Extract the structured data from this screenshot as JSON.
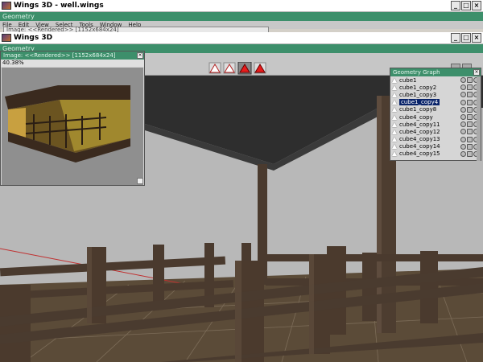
{
  "outer_window": {
    "title": "Wings 3D - well.wings",
    "geometry_label": "Geometry"
  },
  "menus": [
    "File",
    "Edit",
    "View",
    "Select",
    "Tools",
    "Window",
    "Help"
  ],
  "image_title_strip": "Image: <<Rendered>> [1152x684x24]",
  "inner_window": {
    "title": "Wings 3D",
    "geometry_label": "Geometry"
  },
  "image_window": {
    "title": "Image: <<Rendered>> [1152x684x24]",
    "zoom": "40.38%"
  },
  "selection_mode_buttons": [
    "vertex-mode",
    "edge-mode",
    "face-mode",
    "body-mode"
  ],
  "geometry_graph": {
    "title": "Geometry Graph",
    "items": [
      "cube1",
      "cube1_copy2",
      "cube1_copy3",
      "cube1_copy4",
      "cube1_copy8",
      "cube4_copy",
      "cube4_copy11",
      "cube4_copy12",
      "cube4_copy13",
      "cube4_copy14",
      "cube4_copy15"
    ],
    "selected": "cube1_copy4"
  },
  "colors": {
    "geometry_bar": "#3d8f6b",
    "selected": "#0a246a",
    "wood": "#4a3a2e",
    "roof": "#2e2e2e",
    "floor": "#5a4a36"
  }
}
